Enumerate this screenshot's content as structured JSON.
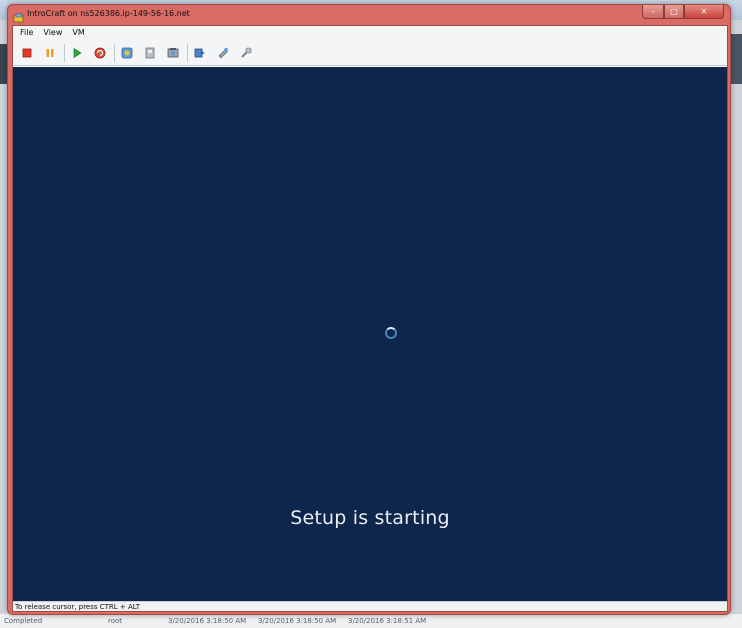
{
  "window": {
    "title": "IntroCraft on ns526386.ip-149-56-16.net",
    "controls": {
      "minimize": "–",
      "maximize": "□",
      "close": "✕"
    }
  },
  "menu": [
    "File",
    "View",
    "VM"
  ],
  "toolbar": [
    {
      "icon": "stop-icon"
    },
    {
      "icon": "pause-icon"
    },
    {
      "icon": "play-icon"
    },
    {
      "icon": "reset-icon"
    },
    {
      "icon": "snapshot-icon"
    },
    {
      "icon": "revert-icon"
    },
    {
      "icon": "snapshot-manager-icon"
    },
    {
      "icon": "share-icon"
    },
    {
      "icon": "settings-icon"
    },
    {
      "icon": "tools-icon"
    }
  ],
  "screen": {
    "message": "Setup is starting",
    "background": "#0e264c"
  },
  "statusbar": {
    "text": "To release cursor, press CTRL + ALT"
  },
  "background_app": {
    "row": {
      "status": "Completed",
      "user": "root",
      "time1": "3/20/2016 3:18:50 AM",
      "time2": "3/20/2016 3:18:50 AM",
      "time3": "3/20/2016 3:18:51 AM"
    }
  },
  "colors": {
    "frame": "#d96a64",
    "screen": "#0e264c",
    "text": "#e9eef5"
  }
}
